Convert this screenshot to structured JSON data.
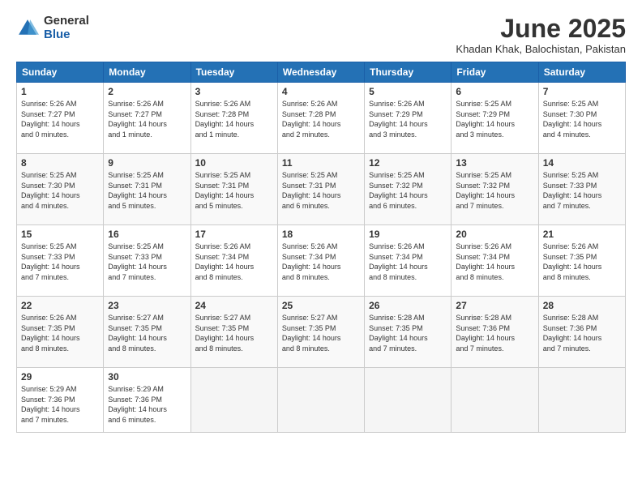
{
  "logo": {
    "general": "General",
    "blue": "Blue"
  },
  "title": "June 2025",
  "location": "Khadan Khak, Balochistan, Pakistan",
  "weekdays": [
    "Sunday",
    "Monday",
    "Tuesday",
    "Wednesday",
    "Thursday",
    "Friday",
    "Saturday"
  ],
  "weeks": [
    [
      {
        "day": "1",
        "info": "Sunrise: 5:26 AM\nSunset: 7:27 PM\nDaylight: 14 hours\nand 0 minutes."
      },
      {
        "day": "2",
        "info": "Sunrise: 5:26 AM\nSunset: 7:27 PM\nDaylight: 14 hours\nand 1 minute."
      },
      {
        "day": "3",
        "info": "Sunrise: 5:26 AM\nSunset: 7:28 PM\nDaylight: 14 hours\nand 1 minute."
      },
      {
        "day": "4",
        "info": "Sunrise: 5:26 AM\nSunset: 7:28 PM\nDaylight: 14 hours\nand 2 minutes."
      },
      {
        "day": "5",
        "info": "Sunrise: 5:26 AM\nSunset: 7:29 PM\nDaylight: 14 hours\nand 3 minutes."
      },
      {
        "day": "6",
        "info": "Sunrise: 5:25 AM\nSunset: 7:29 PM\nDaylight: 14 hours\nand 3 minutes."
      },
      {
        "day": "7",
        "info": "Sunrise: 5:25 AM\nSunset: 7:30 PM\nDaylight: 14 hours\nand 4 minutes."
      }
    ],
    [
      {
        "day": "8",
        "info": "Sunrise: 5:25 AM\nSunset: 7:30 PM\nDaylight: 14 hours\nand 4 minutes."
      },
      {
        "day": "9",
        "info": "Sunrise: 5:25 AM\nSunset: 7:31 PM\nDaylight: 14 hours\nand 5 minutes."
      },
      {
        "day": "10",
        "info": "Sunrise: 5:25 AM\nSunset: 7:31 PM\nDaylight: 14 hours\nand 5 minutes."
      },
      {
        "day": "11",
        "info": "Sunrise: 5:25 AM\nSunset: 7:31 PM\nDaylight: 14 hours\nand 6 minutes."
      },
      {
        "day": "12",
        "info": "Sunrise: 5:25 AM\nSunset: 7:32 PM\nDaylight: 14 hours\nand 6 minutes."
      },
      {
        "day": "13",
        "info": "Sunrise: 5:25 AM\nSunset: 7:32 PM\nDaylight: 14 hours\nand 7 minutes."
      },
      {
        "day": "14",
        "info": "Sunrise: 5:25 AM\nSunset: 7:33 PM\nDaylight: 14 hours\nand 7 minutes."
      }
    ],
    [
      {
        "day": "15",
        "info": "Sunrise: 5:25 AM\nSunset: 7:33 PM\nDaylight: 14 hours\nand 7 minutes."
      },
      {
        "day": "16",
        "info": "Sunrise: 5:25 AM\nSunset: 7:33 PM\nDaylight: 14 hours\nand 7 minutes."
      },
      {
        "day": "17",
        "info": "Sunrise: 5:26 AM\nSunset: 7:34 PM\nDaylight: 14 hours\nand 8 minutes."
      },
      {
        "day": "18",
        "info": "Sunrise: 5:26 AM\nSunset: 7:34 PM\nDaylight: 14 hours\nand 8 minutes."
      },
      {
        "day": "19",
        "info": "Sunrise: 5:26 AM\nSunset: 7:34 PM\nDaylight: 14 hours\nand 8 minutes."
      },
      {
        "day": "20",
        "info": "Sunrise: 5:26 AM\nSunset: 7:34 PM\nDaylight: 14 hours\nand 8 minutes."
      },
      {
        "day": "21",
        "info": "Sunrise: 5:26 AM\nSunset: 7:35 PM\nDaylight: 14 hours\nand 8 minutes."
      }
    ],
    [
      {
        "day": "22",
        "info": "Sunrise: 5:26 AM\nSunset: 7:35 PM\nDaylight: 14 hours\nand 8 minutes."
      },
      {
        "day": "23",
        "info": "Sunrise: 5:27 AM\nSunset: 7:35 PM\nDaylight: 14 hours\nand 8 minutes."
      },
      {
        "day": "24",
        "info": "Sunrise: 5:27 AM\nSunset: 7:35 PM\nDaylight: 14 hours\nand 8 minutes."
      },
      {
        "day": "25",
        "info": "Sunrise: 5:27 AM\nSunset: 7:35 PM\nDaylight: 14 hours\nand 8 minutes."
      },
      {
        "day": "26",
        "info": "Sunrise: 5:28 AM\nSunset: 7:35 PM\nDaylight: 14 hours\nand 7 minutes."
      },
      {
        "day": "27",
        "info": "Sunrise: 5:28 AM\nSunset: 7:36 PM\nDaylight: 14 hours\nand 7 minutes."
      },
      {
        "day": "28",
        "info": "Sunrise: 5:28 AM\nSunset: 7:36 PM\nDaylight: 14 hours\nand 7 minutes."
      }
    ],
    [
      {
        "day": "29",
        "info": "Sunrise: 5:29 AM\nSunset: 7:36 PM\nDaylight: 14 hours\nand 7 minutes."
      },
      {
        "day": "30",
        "info": "Sunrise: 5:29 AM\nSunset: 7:36 PM\nDaylight: 14 hours\nand 6 minutes."
      },
      {
        "day": "",
        "info": ""
      },
      {
        "day": "",
        "info": ""
      },
      {
        "day": "",
        "info": ""
      },
      {
        "day": "",
        "info": ""
      },
      {
        "day": "",
        "info": ""
      }
    ]
  ]
}
